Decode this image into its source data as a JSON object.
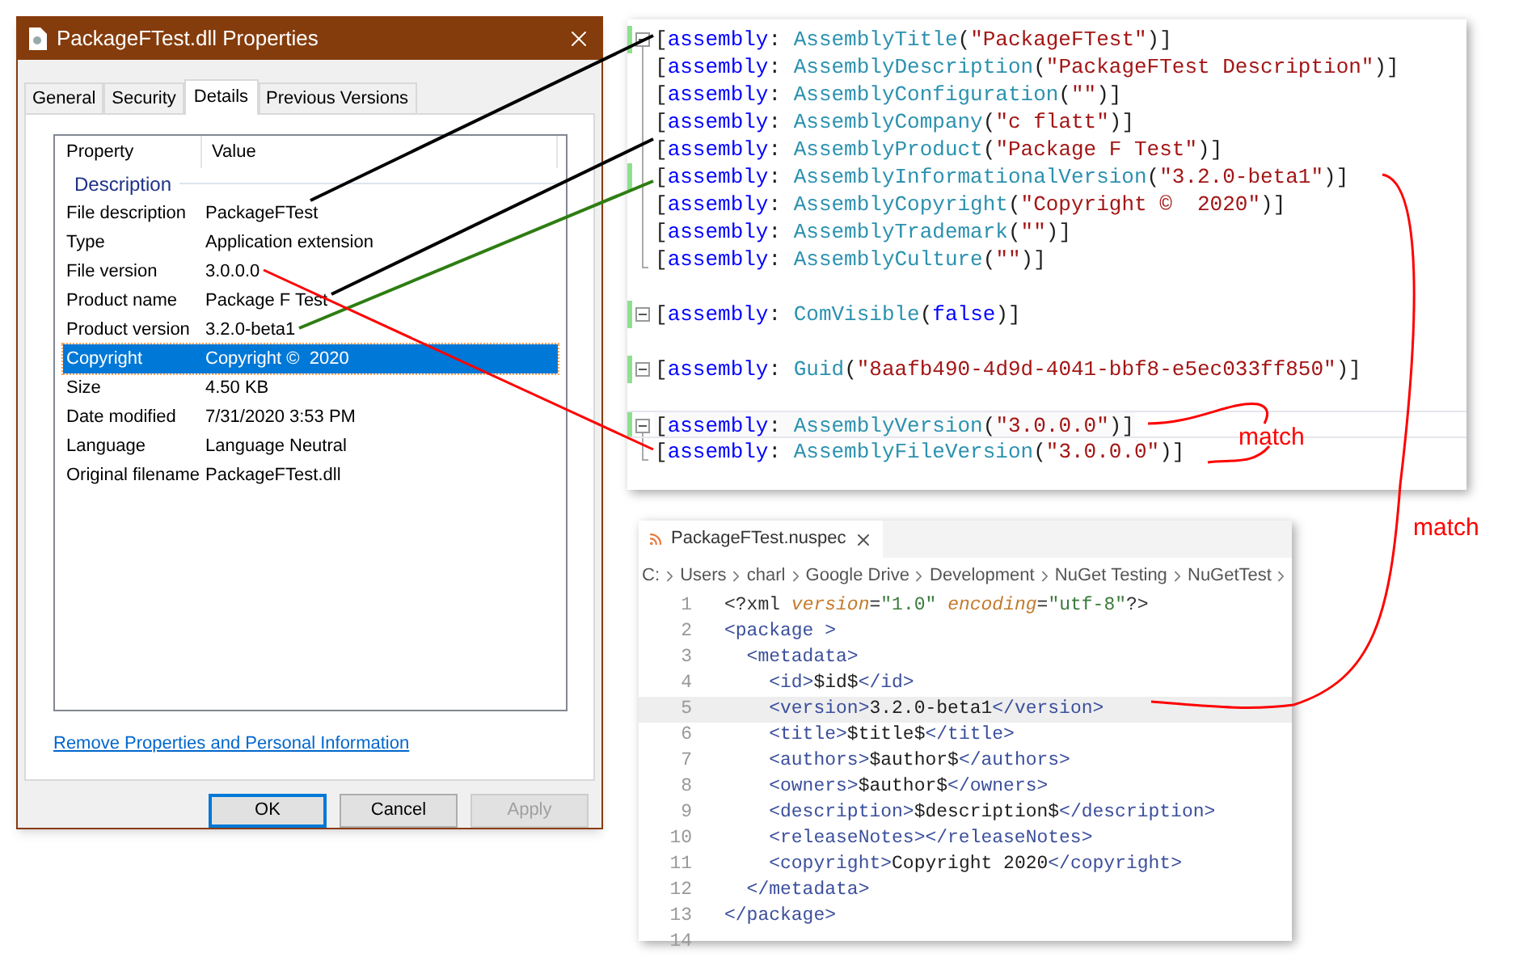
{
  "properties_dialog": {
    "title": "PackageFTest.dll Properties",
    "tabs": [
      {
        "label": "General",
        "selected": false
      },
      {
        "label": "Security",
        "selected": false
      },
      {
        "label": "Details",
        "selected": true
      },
      {
        "label": "Previous Versions",
        "selected": false
      }
    ],
    "columns": [
      "Property",
      "Value"
    ],
    "group": "Description",
    "rows": [
      {
        "property": "File description",
        "value": "PackageFTest",
        "selected": false
      },
      {
        "property": "Type",
        "value": "Application extension",
        "selected": false
      },
      {
        "property": "File version",
        "value": "3.0.0.0",
        "selected": false
      },
      {
        "property": "Product name",
        "value": "Package F Test",
        "selected": false
      },
      {
        "property": "Product version",
        "value": "3.2.0-beta1",
        "selected": false
      },
      {
        "property": "Copyright",
        "value": "Copyright ©  2020",
        "selected": true
      },
      {
        "property": "Size",
        "value": "4.50 KB",
        "selected": false
      },
      {
        "property": "Date modified",
        "value": "7/31/2020 3:53 PM",
        "selected": false
      },
      {
        "property": "Language",
        "value": "Language Neutral",
        "selected": false
      },
      {
        "property": "Original filename",
        "value": "PackageFTest.dll",
        "selected": false
      }
    ],
    "link": "Remove Properties and Personal Information",
    "buttons": [
      {
        "label": "OK",
        "default": true,
        "disabled": false
      },
      {
        "label": "Cancel",
        "default": false,
        "disabled": false
      },
      {
        "label": "Apply",
        "default": false,
        "disabled": true
      }
    ]
  },
  "assembly_info_editor": {
    "lines": [
      {
        "kind": "code",
        "fold": {
          "kind": "start"
        },
        "changed": true,
        "current": false,
        "tokens": [
          {
            "kind": "p",
            "text": "["
          },
          {
            "kind": "k",
            "text": "assembly"
          },
          {
            "kind": "p",
            "text": ": "
          },
          {
            "kind": "t",
            "text": "AssemblyTitle"
          },
          {
            "kind": "p",
            "text": "("
          },
          {
            "kind": "s",
            "text": "\"PackageFTest\""
          },
          {
            "kind": "p",
            "text": ")]"
          }
        ]
      },
      {
        "kind": "code",
        "fold": {
          "kind": "inner"
        },
        "changed": false,
        "current": false,
        "tokens": [
          {
            "kind": "p",
            "text": "["
          },
          {
            "kind": "k",
            "text": "assembly"
          },
          {
            "kind": "p",
            "text": ": "
          },
          {
            "kind": "t",
            "text": "AssemblyDescription"
          },
          {
            "kind": "p",
            "text": "("
          },
          {
            "kind": "s",
            "text": "\"PackageFTest Description\""
          },
          {
            "kind": "p",
            "text": ")]"
          }
        ]
      },
      {
        "kind": "code",
        "fold": {
          "kind": "inner"
        },
        "changed": false,
        "current": false,
        "tokens": [
          {
            "kind": "p",
            "text": "["
          },
          {
            "kind": "k",
            "text": "assembly"
          },
          {
            "kind": "p",
            "text": ": "
          },
          {
            "kind": "t",
            "text": "AssemblyConfiguration"
          },
          {
            "kind": "p",
            "text": "("
          },
          {
            "kind": "s",
            "text": "\"\""
          },
          {
            "kind": "p",
            "text": ")]"
          }
        ]
      },
      {
        "kind": "code",
        "fold": {
          "kind": "inner"
        },
        "changed": false,
        "current": false,
        "tokens": [
          {
            "kind": "p",
            "text": "["
          },
          {
            "kind": "k",
            "text": "assembly"
          },
          {
            "kind": "p",
            "text": ": "
          },
          {
            "kind": "t",
            "text": "AssemblyCompany"
          },
          {
            "kind": "p",
            "text": "("
          },
          {
            "kind": "s",
            "text": "\"c flatt\""
          },
          {
            "kind": "p",
            "text": ")]"
          }
        ]
      },
      {
        "kind": "code",
        "fold": {
          "kind": "inner"
        },
        "changed": false,
        "current": false,
        "tokens": [
          {
            "kind": "p",
            "text": "["
          },
          {
            "kind": "k",
            "text": "assembly"
          },
          {
            "kind": "p",
            "text": ": "
          },
          {
            "kind": "t",
            "text": "AssemblyProduct"
          },
          {
            "kind": "p",
            "text": "("
          },
          {
            "kind": "s",
            "text": "\"Package F Test\""
          },
          {
            "kind": "p",
            "text": ")]"
          }
        ]
      },
      {
        "kind": "code",
        "fold": {
          "kind": "inner"
        },
        "changed": true,
        "current": false,
        "tokens": [
          {
            "kind": "p",
            "text": "["
          },
          {
            "kind": "k",
            "text": "assembly"
          },
          {
            "kind": "p",
            "text": ": "
          },
          {
            "kind": "t",
            "text": "AssemblyInformationalVersion"
          },
          {
            "kind": "p",
            "text": "("
          },
          {
            "kind": "s",
            "text": "\"3.2.0-beta1\""
          },
          {
            "kind": "p",
            "text": ")]"
          }
        ]
      },
      {
        "kind": "code",
        "fold": {
          "kind": "inner"
        },
        "changed": false,
        "current": false,
        "tokens": [
          {
            "kind": "p",
            "text": "["
          },
          {
            "kind": "k",
            "text": "assembly"
          },
          {
            "kind": "p",
            "text": ": "
          },
          {
            "kind": "t",
            "text": "AssemblyCopyright"
          },
          {
            "kind": "p",
            "text": "("
          },
          {
            "kind": "s",
            "text": "\"Copyright ©  2020\""
          },
          {
            "kind": "p",
            "text": ")]"
          }
        ]
      },
      {
        "kind": "code",
        "fold": {
          "kind": "inner"
        },
        "changed": false,
        "current": false,
        "tokens": [
          {
            "kind": "p",
            "text": "["
          },
          {
            "kind": "k",
            "text": "assembly"
          },
          {
            "kind": "p",
            "text": ": "
          },
          {
            "kind": "t",
            "text": "AssemblyTrademark"
          },
          {
            "kind": "p",
            "text": "("
          },
          {
            "kind": "s",
            "text": "\"\""
          },
          {
            "kind": "p",
            "text": ")]"
          }
        ]
      },
      {
        "kind": "code",
        "fold": {
          "kind": "end"
        },
        "changed": false,
        "current": false,
        "tokens": [
          {
            "kind": "p",
            "text": "["
          },
          {
            "kind": "k",
            "text": "assembly"
          },
          {
            "kind": "p",
            "text": ": "
          },
          {
            "kind": "t",
            "text": "AssemblyCulture"
          },
          {
            "kind": "p",
            "text": "("
          },
          {
            "kind": "s",
            "text": "\"\""
          },
          {
            "kind": "p",
            "text": ")]"
          }
        ]
      },
      {
        "kind": "blank"
      },
      {
        "kind": "code",
        "fold": {
          "kind": "single"
        },
        "changed": true,
        "current": false,
        "tokens": [
          {
            "kind": "p",
            "text": "["
          },
          {
            "kind": "k",
            "text": "assembly"
          },
          {
            "kind": "p",
            "text": ": "
          },
          {
            "kind": "t",
            "text": "ComVisible"
          },
          {
            "kind": "p",
            "text": "("
          },
          {
            "kind": "k",
            "text": "false"
          },
          {
            "kind": "p",
            "text": ")]"
          }
        ]
      },
      {
        "kind": "blank"
      },
      {
        "kind": "code",
        "fold": {
          "kind": "single"
        },
        "changed": true,
        "current": false,
        "tokens": [
          {
            "kind": "p",
            "text": "["
          },
          {
            "kind": "k",
            "text": "assembly"
          },
          {
            "kind": "p",
            "text": ": "
          },
          {
            "kind": "t",
            "text": "Guid"
          },
          {
            "kind": "p",
            "text": "("
          },
          {
            "kind": "s",
            "text": "\"8aafb490-4d9d-4041-bbf8-e5ec033ff850\""
          },
          {
            "kind": "p",
            "text": ")]"
          }
        ]
      },
      {
        "kind": "blank"
      },
      {
        "kind": "code",
        "fold": {
          "kind": "start"
        },
        "changed": true,
        "current": true,
        "tokens": [
          {
            "kind": "p",
            "text": "["
          },
          {
            "kind": "k",
            "text": "assembly"
          },
          {
            "kind": "p",
            "text": ": "
          },
          {
            "kind": "t",
            "text": "AssemblyVersion"
          },
          {
            "kind": "p",
            "text": "("
          },
          {
            "kind": "s",
            "text": "\"3.0.0.0\""
          },
          {
            "kind": "p",
            "text": ")]"
          }
        ]
      },
      {
        "kind": "code",
        "fold": {
          "kind": "end"
        },
        "changed": false,
        "current": false,
        "tokens": [
          {
            "kind": "p",
            "text": "["
          },
          {
            "kind": "k",
            "text": "assembly"
          },
          {
            "kind": "p",
            "text": ": "
          },
          {
            "kind": "t",
            "text": "AssemblyFileVersion"
          },
          {
            "kind": "p",
            "text": "("
          },
          {
            "kind": "s",
            "text": "\"3.0.0.0\""
          },
          {
            "kind": "p",
            "text": ")]"
          }
        ]
      }
    ]
  },
  "nuspec_editor": {
    "tab": "PackageFTest.nuspec",
    "breadcrumb": [
      "C:",
      "Users",
      "charl",
      "Google Drive",
      "Development",
      "NuGet Testing",
      "NuGetTest"
    ],
    "lines": [
      {
        "number": "1",
        "current": false,
        "tokens": [
          {
            "kind": "p",
            "text": "<?xml "
          },
          {
            "kind": "a",
            "text": "version"
          },
          {
            "kind": "p",
            "text": "="
          },
          {
            "kind": "s",
            "text": "\"1.0\" "
          },
          {
            "kind": "a",
            "text": "encoding"
          },
          {
            "kind": "p",
            "text": "="
          },
          {
            "kind": "s",
            "text": "\"utf-8\""
          },
          {
            "kind": "p",
            "text": "?>"
          }
        ]
      },
      {
        "number": "2",
        "current": false,
        "tokens": [
          {
            "kind": "g",
            "text": "<package >"
          }
        ]
      },
      {
        "number": "3",
        "current": false,
        "tokens": [
          {
            "kind": "g",
            "text": "  <metadata>"
          }
        ]
      },
      {
        "number": "4",
        "current": false,
        "tokens": [
          {
            "kind": "g",
            "text": "    <id>"
          },
          {
            "kind": "x",
            "text": "$id$"
          },
          {
            "kind": "g",
            "text": "</id>"
          }
        ]
      },
      {
        "number": "5",
        "current": true,
        "tokens": [
          {
            "kind": "g",
            "text": "    <version>"
          },
          {
            "kind": "x",
            "text": "3.2.0-beta1"
          },
          {
            "kind": "g",
            "text": "</version>"
          }
        ]
      },
      {
        "number": "6",
        "current": false,
        "tokens": [
          {
            "kind": "g",
            "text": "    <title>"
          },
          {
            "kind": "x",
            "text": "$title$"
          },
          {
            "kind": "g",
            "text": "</title>"
          }
        ]
      },
      {
        "number": "7",
        "current": false,
        "tokens": [
          {
            "kind": "g",
            "text": "    <authors>"
          },
          {
            "kind": "x",
            "text": "$author$"
          },
          {
            "kind": "g",
            "text": "</authors>"
          }
        ]
      },
      {
        "number": "8",
        "current": false,
        "tokens": [
          {
            "kind": "g",
            "text": "    <owners>"
          },
          {
            "kind": "x",
            "text": "$author$"
          },
          {
            "kind": "g",
            "text": "</owners>"
          }
        ]
      },
      {
        "number": "9",
        "current": false,
        "tokens": [
          {
            "kind": "g",
            "text": "    <description>"
          },
          {
            "kind": "x",
            "text": "$description$"
          },
          {
            "kind": "g",
            "text": "</description>"
          }
        ]
      },
      {
        "number": "10",
        "current": false,
        "tokens": [
          {
            "kind": "g",
            "text": "    <releaseNotes></releaseNotes>"
          }
        ]
      },
      {
        "number": "11",
        "current": false,
        "tokens": [
          {
            "kind": "g",
            "text": "    <copyright>"
          },
          {
            "kind": "x",
            "text": "Copyright 2020"
          },
          {
            "kind": "g",
            "text": "</copyright>"
          }
        ]
      },
      {
        "number": "12",
        "current": false,
        "tokens": [
          {
            "kind": "g",
            "text": "  </metadata>"
          }
        ]
      },
      {
        "number": "13",
        "current": false,
        "tokens": [
          {
            "kind": "g",
            "text": "</package>"
          }
        ]
      },
      {
        "number": "14",
        "current": false
      }
    ]
  },
  "annotations": {
    "labels": [
      "match",
      "match"
    ]
  }
}
